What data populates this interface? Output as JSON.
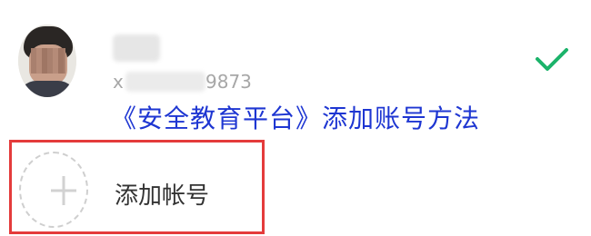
{
  "account": {
    "id_prefix": "x",
    "id_suffix": "9873",
    "selected_icon": "checkmark-icon",
    "check_color": "#1bb36a"
  },
  "overlay_title": "《安全教育平台》添加账号方法",
  "add_account": {
    "label": "添加帐号",
    "icon": "plus-icon",
    "highlight_color": "#e43b3b"
  }
}
